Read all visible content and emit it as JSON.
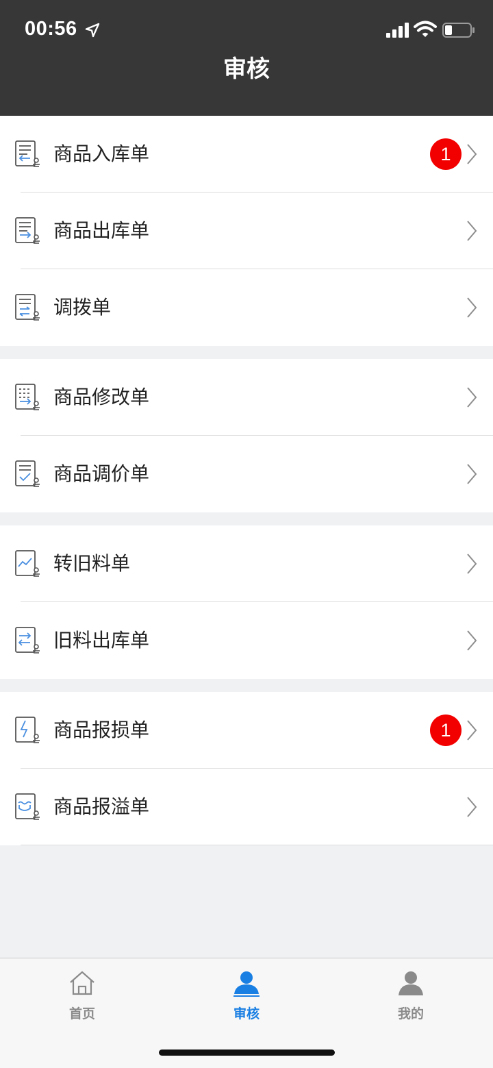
{
  "status_bar": {
    "time": "00:56"
  },
  "header": {
    "title": "审核"
  },
  "groups": [
    {
      "items": [
        {
          "label": "商品入库单",
          "badge": "1",
          "icon": "stock-in-doc-icon"
        },
        {
          "label": "商品出库单",
          "badge": null,
          "icon": "stock-out-doc-icon"
        },
        {
          "label": "调拨单",
          "badge": null,
          "icon": "transfer-doc-icon"
        }
      ]
    },
    {
      "items": [
        {
          "label": "商品修改单",
          "badge": null,
          "icon": "modify-doc-icon"
        },
        {
          "label": "商品调价单",
          "badge": null,
          "icon": "price-adjust-doc-icon"
        }
      ]
    },
    {
      "items": [
        {
          "label": "转旧料单",
          "badge": null,
          "icon": "old-material-doc-icon"
        },
        {
          "label": "旧料出库单",
          "badge": null,
          "icon": "old-material-out-doc-icon"
        }
      ]
    },
    {
      "items": [
        {
          "label": "商品报损单",
          "badge": "1",
          "icon": "loss-report-doc-icon"
        },
        {
          "label": "商品报溢单",
          "badge": null,
          "icon": "overflow-report-doc-icon"
        }
      ]
    }
  ],
  "tabbar": {
    "tabs": [
      {
        "label": "首页",
        "icon": "home-icon",
        "active": false
      },
      {
        "label": "审核",
        "icon": "person-icon",
        "active": true
      },
      {
        "label": "我的",
        "icon": "profile-icon",
        "active": false
      }
    ]
  },
  "colors": {
    "header_bg": "#373737",
    "badge": "#f20000",
    "accent": "#1a7fe3",
    "icon_blue": "#4a8fe0"
  }
}
